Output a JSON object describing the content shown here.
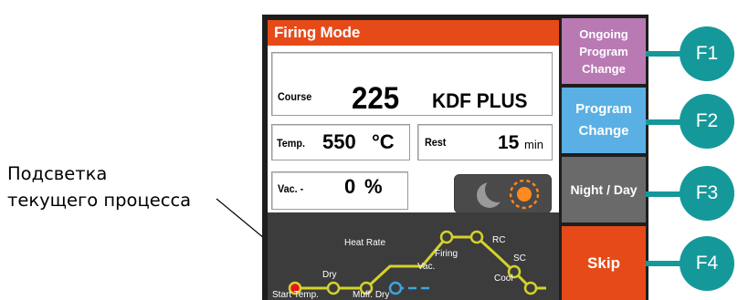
{
  "annotation": {
    "line1": "Подсветка",
    "line2": "текущего процесса"
  },
  "screen": {
    "title": "Firing Mode",
    "course": {
      "label": "Course",
      "number": "225",
      "name": "KDF PLUS"
    },
    "temp": {
      "label": "Temp.",
      "value": "550",
      "unit": "°C"
    },
    "rest": {
      "label": "Rest",
      "value": "15",
      "unit": "min"
    },
    "vac": {
      "label": "Vac. -",
      "value": "0",
      "unit": "%"
    },
    "stages": {
      "start_temp": "Start Temp.",
      "dry": "Dry",
      "muff_dry": "Muff. Dry",
      "heat_rate": "Heat Rate",
      "vac": "Vac.",
      "firing": "Firing",
      "rc": "RC",
      "sc": "SC",
      "cool": "Cool"
    }
  },
  "softkeys": {
    "f1": {
      "line1": "Ongoing",
      "line2": "Program",
      "line3": "Change"
    },
    "f2": {
      "line1": "Program",
      "line2": "Change"
    },
    "f3": "Night / Day",
    "f4": "Skip"
  },
  "fkeys": [
    "F1",
    "F2",
    "F3",
    "F4"
  ],
  "colors": {
    "title_bar": "#e64a19",
    "graph_bg": "#3c3c3c",
    "curve": "#d4d22a",
    "vac_curve": "#3aa5e0",
    "active_stage": "#e8141e",
    "ongoing_key": "#b97ab4",
    "program_key": "#5ab0e4",
    "nightday_key": "#6a6a6a",
    "skip_key": "#e64a19",
    "fkey": "#15989a",
    "sun": "#ff8a1f"
  },
  "icons": {
    "night": "moon-icon",
    "day": "sun-icon"
  }
}
